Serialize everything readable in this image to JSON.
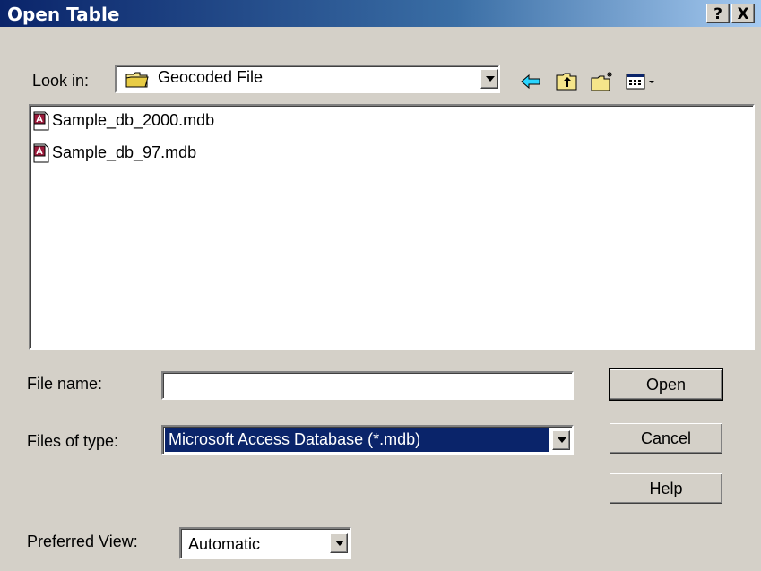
{
  "window": {
    "title": "Open Table",
    "help_label": "?",
    "close_label": "X"
  },
  "lookin": {
    "label": "Look in:",
    "value": "Geocoded File"
  },
  "toolbar": {
    "icons": [
      "back-arrow-icon",
      "up-folder-icon",
      "new-folder-icon",
      "view-menu-icon"
    ]
  },
  "files": [
    {
      "name": "Sample_db_2000.mdb",
      "icon": "access-db-icon"
    },
    {
      "name": "Sample_db_97.mdb",
      "icon": "access-db-icon"
    }
  ],
  "filename": {
    "label": "File name:",
    "value": ""
  },
  "filetype": {
    "label": "Files of type:",
    "value": "Microsoft Access Database (*.mdb)"
  },
  "buttons": {
    "open": "Open",
    "cancel": "Cancel",
    "help": "Help"
  },
  "preferred_view": {
    "label": "Preferred View:",
    "value": "Automatic"
  },
  "colors": {
    "title_start": "#0a246a",
    "title_end": "#a6caf0",
    "face": "#d4d0c8",
    "selection": "#0a246a"
  }
}
